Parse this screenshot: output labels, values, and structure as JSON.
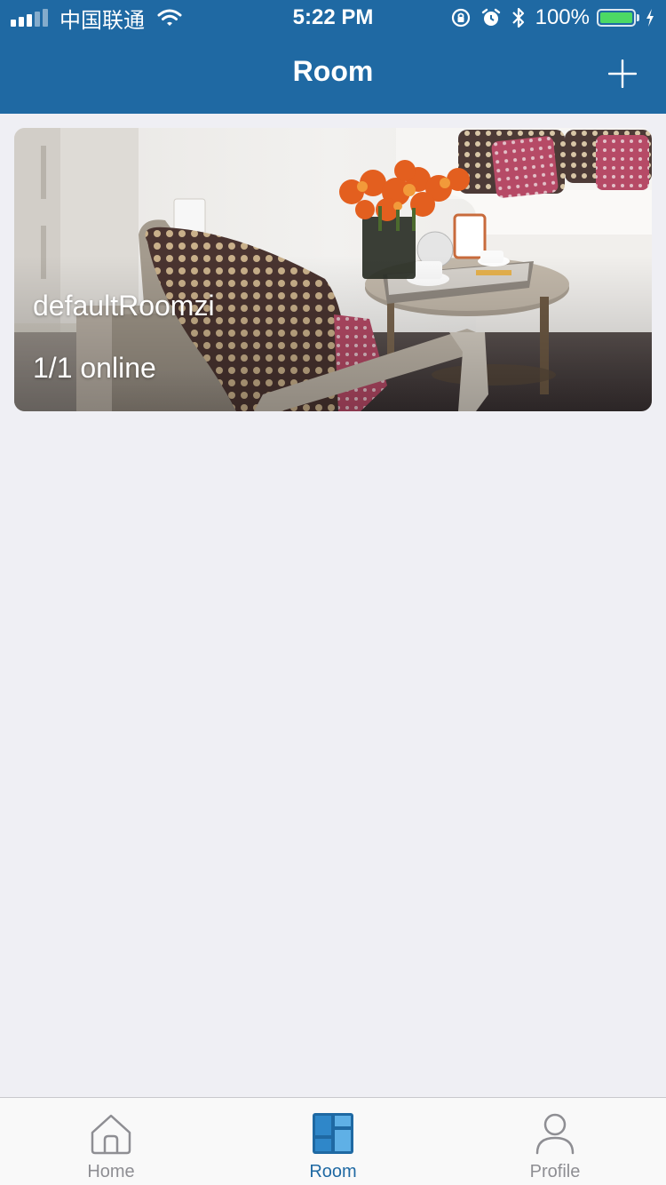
{
  "status_bar": {
    "carrier": "中国联通",
    "time": "5:22 PM",
    "battery_percent": "100%",
    "battery_level": 1.0,
    "icons": [
      "signal-icon",
      "wifi-icon",
      "rotation-lock-icon",
      "alarm-icon",
      "bluetooth-icon",
      "battery-icon",
      "charging-icon"
    ]
  },
  "nav": {
    "title": "Room",
    "add_icon": "plus-icon"
  },
  "rooms": [
    {
      "name": "defaultRoomzi",
      "status": "1/1 online"
    }
  ],
  "tabbar": {
    "tabs": [
      {
        "label": "Home",
        "icon": "home-icon",
        "active": false
      },
      {
        "label": "Room",
        "icon": "room-grid-icon",
        "active": true
      },
      {
        "label": "Profile",
        "icon": "person-icon",
        "active": false
      }
    ]
  },
  "colors": {
    "header": "#1f69a3",
    "background": "#efeff4",
    "tab_active": "#1f69a3",
    "tab_inactive": "#8e8e93",
    "battery": "#4cd964"
  }
}
